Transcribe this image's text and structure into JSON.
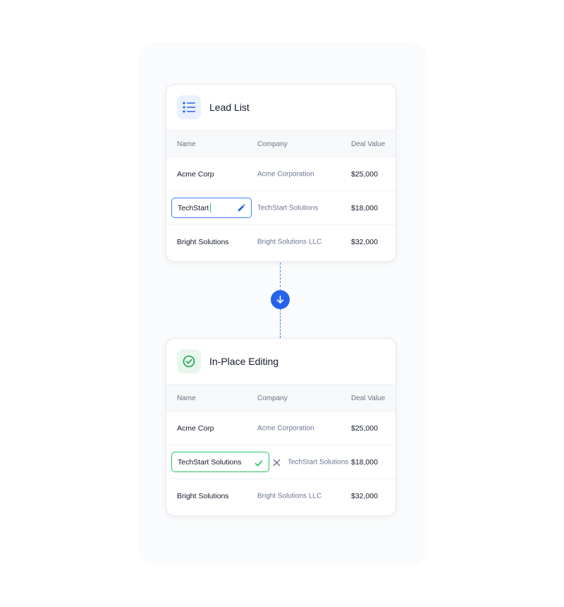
{
  "lead_list": {
    "title": "Lead List",
    "icon": "list-icon",
    "columns": [
      "Name",
      "Company",
      "Deal Value"
    ],
    "rows": [
      {
        "name": "Acme Corp",
        "company": "Acme Corporation",
        "value": "$25,000"
      },
      {
        "name": "TechStart",
        "company": "TechStart Solutions",
        "value": "$18,000",
        "editing": true
      },
      {
        "name": "Bright Solutions",
        "company": "Bright Solutions LLC",
        "value": "$32,000"
      }
    ]
  },
  "connector": {
    "icon": "arrow-down-icon",
    "color": "#2563eb"
  },
  "in_place_editing": {
    "title": "In-Place Editing",
    "icon": "check-circle-icon",
    "columns": [
      "Name",
      "Company",
      "Deal Value"
    ],
    "rows": [
      {
        "name": "Acme Corp",
        "company": "Acme Corporation",
        "value": "$25,000"
      },
      {
        "name": "TechStart Solutions",
        "company": "TechStart Solutions",
        "value": "$18,000",
        "confirmed": true
      },
      {
        "name": "Bright Solutions",
        "company": "Bright Solutions LLC",
        "value": "$32,000"
      }
    ]
  },
  "colors": {
    "accent_blue": "#3b82f6",
    "success_green": "#22c55e",
    "muted_text": "#6b7591"
  }
}
